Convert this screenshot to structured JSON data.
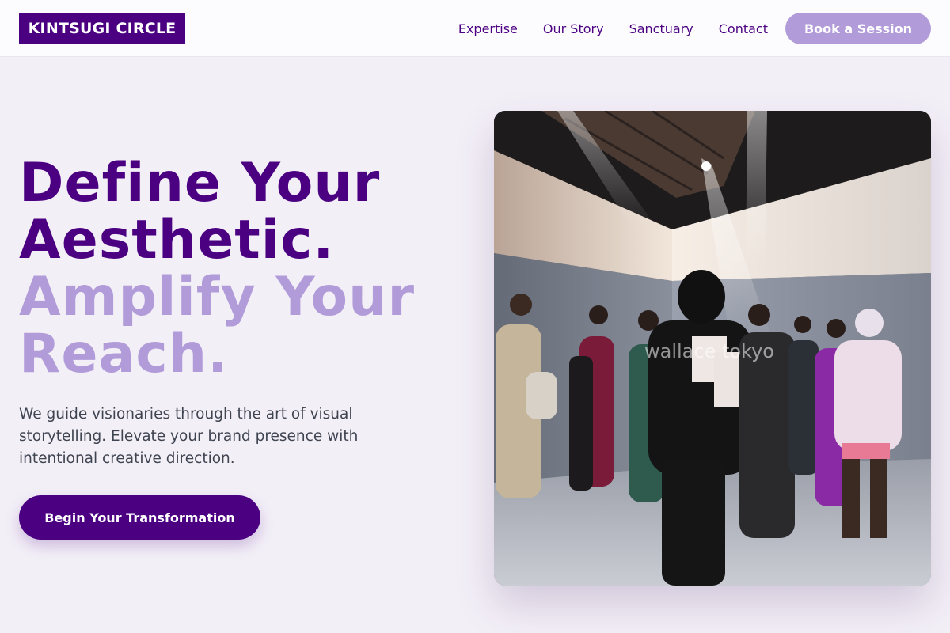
{
  "header": {
    "logo": "KINTSUGI CIRCLE",
    "nav": [
      "Expertise",
      "Our Story",
      "Sanctuary",
      "Contact"
    ],
    "cta": "Book a Session"
  },
  "hero": {
    "headline_line1": "Define Your",
    "headline_line2": "Aesthetic.",
    "headline_line3": "Amplify Your",
    "headline_line4": "Reach.",
    "lede": "We guide visionaries through the art of visual storytelling. Elevate your brand presence with intentional creative direction.",
    "cta": "Begin Your Transformation"
  },
  "photo": {
    "watermark": "wallace tokyo"
  },
  "colors": {
    "primary": "#4b0082",
    "accent": "#b19cd9",
    "background": "#f3eff7",
    "body_text": "#3f4451"
  }
}
